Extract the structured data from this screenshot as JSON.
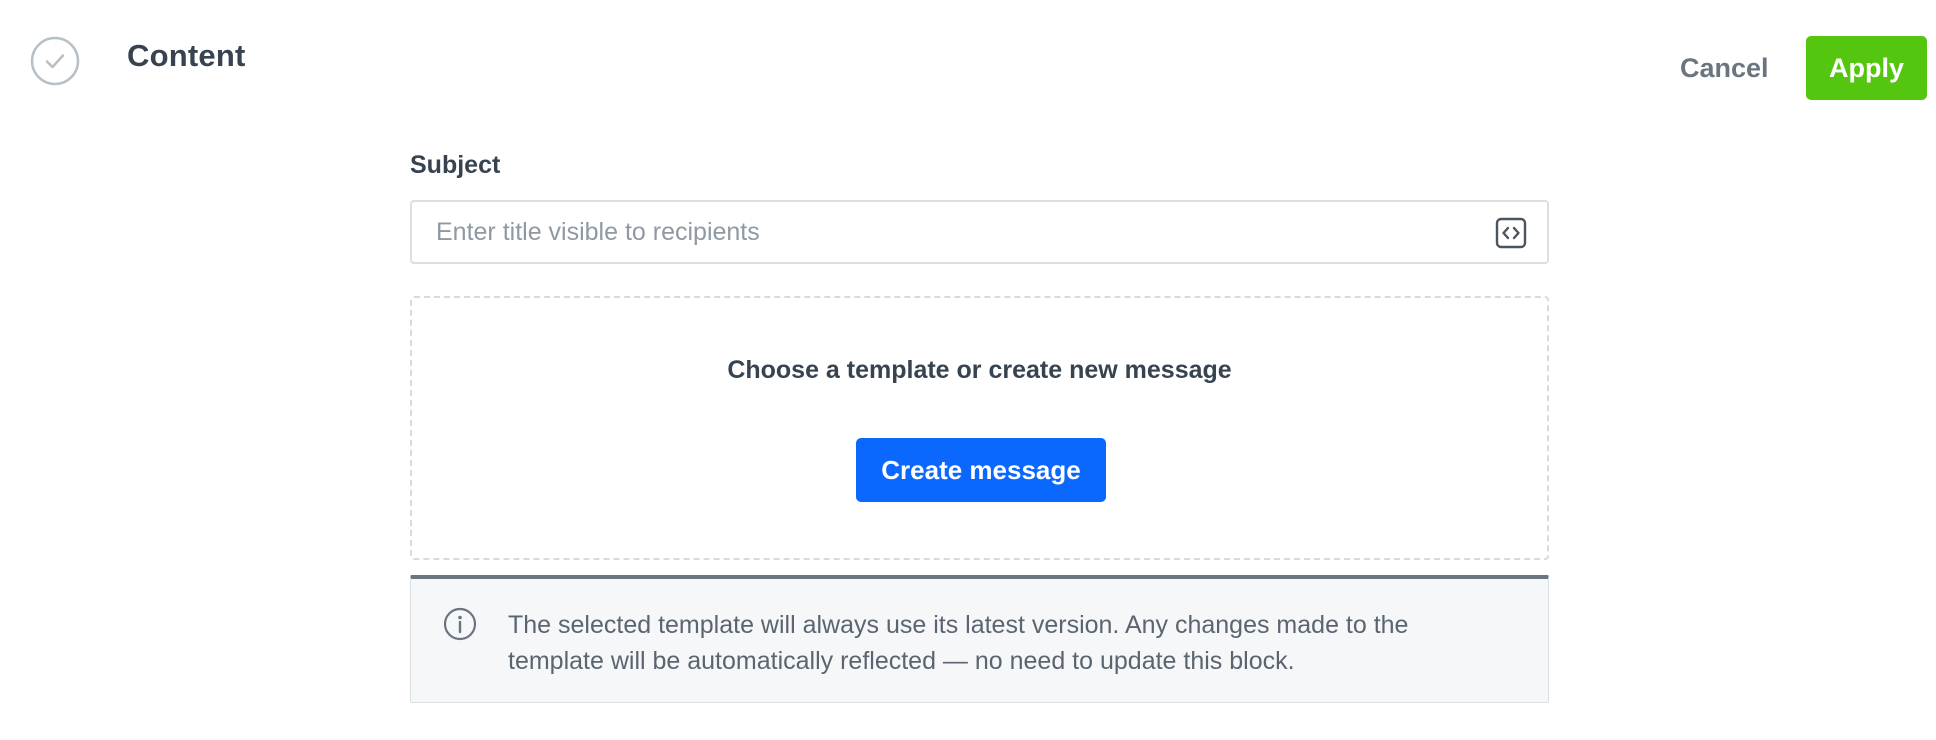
{
  "header": {
    "title": "Content",
    "status_icon": "check-circle-icon",
    "cancel_label": "Cancel",
    "apply_label": "Apply"
  },
  "subject": {
    "label": "Subject",
    "value": "",
    "placeholder": "Enter title visible to recipients",
    "insert_icon": "code-brackets-icon"
  },
  "template": {
    "heading": "Choose a template or create new message",
    "create_label": "Create message"
  },
  "info": {
    "icon": "info-circle-icon",
    "text": "The selected template will always use its latest version. Any changes made to the template will be automatically reflected — no need to update this block."
  },
  "colors": {
    "apply": "#54c60f",
    "primary": "#0b68ff",
    "text": "#384350",
    "muted": "#6a7580"
  }
}
